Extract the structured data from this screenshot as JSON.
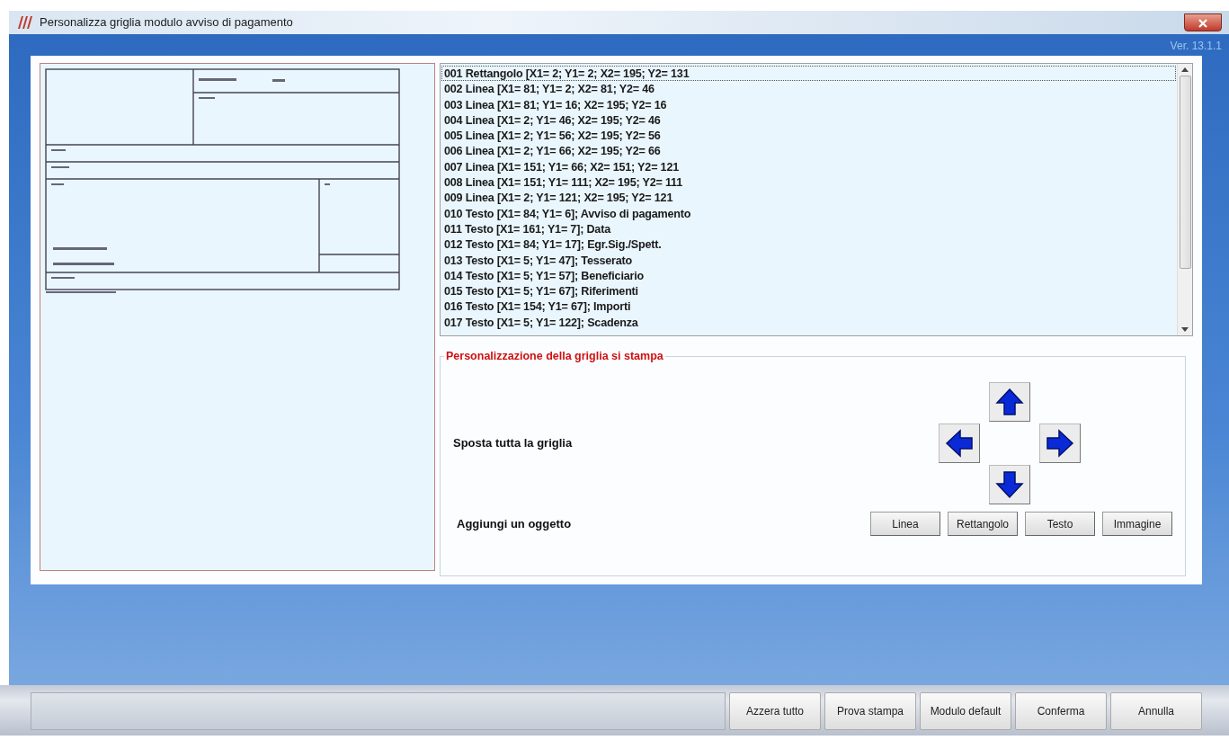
{
  "window": {
    "title": "Personalizza griglia modulo avviso di pagamento",
    "version": "Ver. 13.1.1"
  },
  "objects": [
    {
      "label": "001 Rettangolo [X1= 2; Y1= 2; X2= 195; Y2= 131",
      "selected": true
    },
    {
      "label": "002 Linea [X1= 81; Y1= 2; X2= 81; Y2= 46",
      "selected": false
    },
    {
      "label": "003 Linea [X1= 81; Y1= 16; X2= 195; Y2= 16",
      "selected": false
    },
    {
      "label": "004 Linea [X1= 2; Y1= 46; X2= 195; Y2= 46",
      "selected": false
    },
    {
      "label": "005 Linea [X1= 2; Y1= 56; X2= 195; Y2= 56",
      "selected": false
    },
    {
      "label": "006 Linea [X1= 2; Y1= 66; X2= 195; Y2= 66",
      "selected": false
    },
    {
      "label": "007 Linea [X1= 151; Y1= 66; X2= 151; Y2= 121",
      "selected": false
    },
    {
      "label": "008 Linea [X1= 151; Y1= 111; X2= 195; Y2= 111",
      "selected": false
    },
    {
      "label": "009 Linea [X1= 2; Y1= 121; X2= 195; Y2= 121",
      "selected": false
    },
    {
      "label": "010 Testo [X1= 84; Y1= 6]; Avviso di pagamento",
      "selected": false
    },
    {
      "label": "011 Testo [X1= 161; Y1= 7]; Data",
      "selected": false
    },
    {
      "label": "012 Testo [X1= 84; Y1= 17]; Egr.Sig./Spett.",
      "selected": false
    },
    {
      "label": "013 Testo [X1= 5; Y1= 47]; Tesserato",
      "selected": false
    },
    {
      "label": "014 Testo [X1= 5; Y1= 57]; Beneficiario",
      "selected": false
    },
    {
      "label": "015 Testo [X1= 5; Y1= 67]; Riferimenti",
      "selected": false
    },
    {
      "label": "016 Testo [X1= 154; Y1= 67]; Importi",
      "selected": false
    },
    {
      "label": "017 Testo [X1= 5; Y1= 122]; Scadenza",
      "selected": false
    }
  ],
  "settings": {
    "title": "Personalizzazione della griglia si stampa",
    "move_label": "Sposta tutta la griglia",
    "move_buttons": [
      {
        "kind": "up"
      },
      {
        "kind": "left"
      },
      {
        "kind": "right"
      },
      {
        "kind": "down"
      }
    ],
    "add_label": "Aggiungi un oggetto",
    "add_buttons": [
      "Linea",
      "Rettangolo",
      "Testo",
      "Immagine"
    ]
  },
  "footer_buttons": [
    "Azzera tutto",
    "Prova stampa",
    "Modulo default",
    "Conferma",
    "Annulla"
  ]
}
